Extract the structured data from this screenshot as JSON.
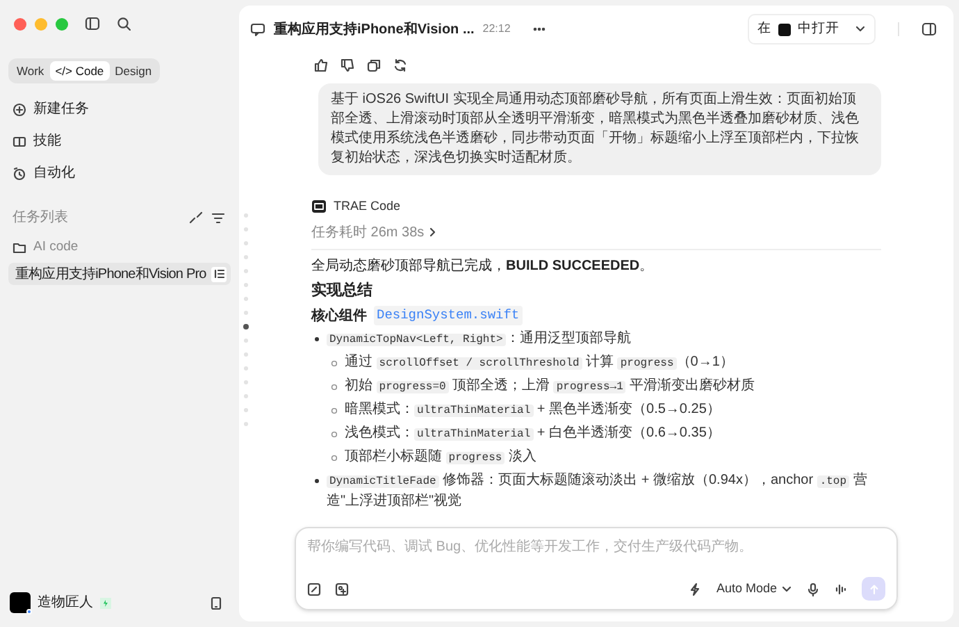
{
  "sidebar": {
    "mode_tabs": [
      {
        "label": "Work",
        "selected": false
      },
      {
        "label": "</> Code",
        "selected": true
      },
      {
        "label": "Design",
        "selected": false
      }
    ],
    "nav_items": [
      {
        "label": "新建任务",
        "kind": "new"
      },
      {
        "label": "技能",
        "kind": "skills"
      },
      {
        "label": "自动化",
        "kind": "automation"
      }
    ],
    "task_list": {
      "title": "任务列表",
      "folder": "AI code",
      "tasks": [
        {
          "title": "重构应用支持iPhone和Vision Pro",
          "selected": true
        }
      ]
    },
    "user": {
      "name": "造物匠人"
    }
  },
  "header": {
    "title": "重构应用支持iPhone和Vision ...",
    "time": "22:12",
    "open_in": {
      "prefix": "在",
      "suffix": "中打开"
    }
  },
  "conversation": {
    "user_message": "基于 iOS26 SwiftUI 实现全局通用动态顶部磨砂导航，所有页面上滑生效：页面初始顶部全透、上滑滚动时顶部从全透明平滑渐变，暗黑模式为黑色半透叠加磨砂材质、浅色模式使用系统浅色半透磨砂，同步带动页面「开物」标题缩小上浮至顶部栏内，下拉恢复初始状态，深浅色切换实时适配材质。",
    "assistant": {
      "name": "TRAE Code",
      "duration": "任务耗时 26m 38s",
      "summary": "全局动态磨砂顶部导航已完成，**BUILD SUCCEEDED**。",
      "heading": "实现总结",
      "component_label": "核心组件",
      "component_file": "DesignSystem.swift",
      "bullets": [
        {
          "segments": [
            {
              "kind": "code",
              "text": "DynamicTopNav<Left, Right>"
            },
            {
              "kind": "text",
              "text": "：通用泛型顶部导航"
            }
          ],
          "children": [
            {
              "segments": [
                {
                  "kind": "text",
                  "text": "通过 "
                },
                {
                  "kind": "code",
                  "text": "scrollOffset / scrollThreshold"
                },
                {
                  "kind": "text",
                  "text": " 计算 "
                },
                {
                  "kind": "code",
                  "text": "progress"
                },
                {
                  "kind": "text",
                  "text": "（0→1）"
                }
              ]
            },
            {
              "segments": [
                {
                  "kind": "text",
                  "text": "初始 "
                },
                {
                  "kind": "code",
                  "text": "progress=0"
                },
                {
                  "kind": "text",
                  "text": " 顶部全透；上滑 "
                },
                {
                  "kind": "code",
                  "text": "progress→1"
                },
                {
                  "kind": "text",
                  "text": " 平滑渐变出磨砂材质"
                }
              ]
            },
            {
              "segments": [
                {
                  "kind": "text",
                  "text": "暗黑模式："
                },
                {
                  "kind": "code",
                  "text": "ultraThinMaterial"
                },
                {
                  "kind": "text",
                  "text": " + 黑色半透渐变（0.5→0.25）"
                }
              ]
            },
            {
              "segments": [
                {
                  "kind": "text",
                  "text": "浅色模式："
                },
                {
                  "kind": "code",
                  "text": "ultraThinMaterial"
                },
                {
                  "kind": "text",
                  "text": " + 白色半透渐变（0.6→0.35）"
                }
              ]
            },
            {
              "segments": [
                {
                  "kind": "text",
                  "text": "顶部栏小标题随 "
                },
                {
                  "kind": "code",
                  "text": "progress"
                },
                {
                  "kind": "text",
                  "text": " 淡入"
                }
              ]
            }
          ]
        },
        {
          "segments": [
            {
              "kind": "code",
              "text": "DynamicTitleFade"
            },
            {
              "kind": "text",
              "text": " 修饰器：页面大标题随滚动淡出 + 微缩放（0.94x），anchor "
            },
            {
              "kind": "code",
              "text": ".top"
            },
            {
              "kind": "text",
              "text": " 营造\"上浮进顶部栏\"视觉"
            }
          ]
        }
      ]
    }
  },
  "composer": {
    "placeholder": "帮你编写代码、调试 Bug、优化性能等开发工作，交付生产级代码产物。",
    "mode": "Auto Mode",
    "send_disabled": true
  }
}
